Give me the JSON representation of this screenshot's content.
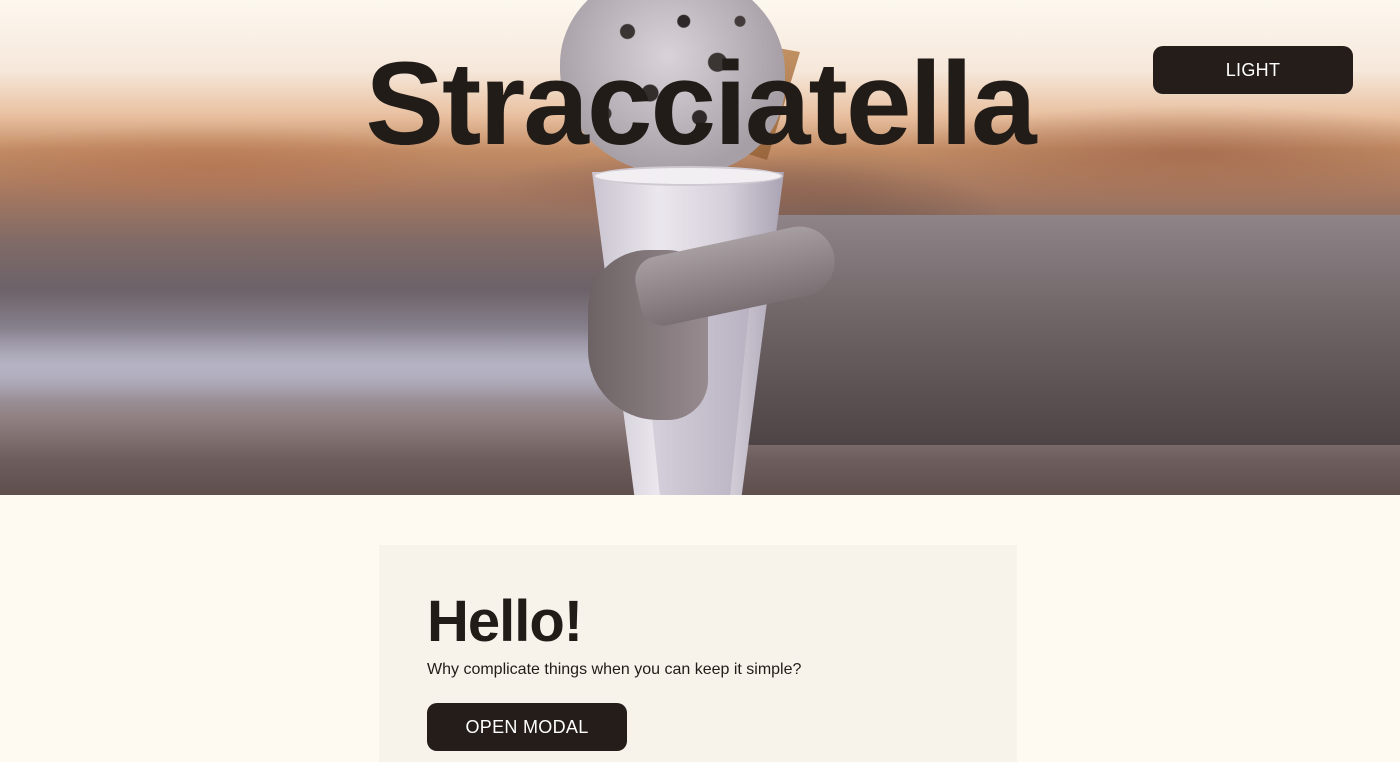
{
  "hero": {
    "title": "Stracciatella",
    "image_alt": "hand holding an ice cream cone",
    "theme_toggle_label": "LIGHT"
  },
  "card": {
    "title": "Hello!",
    "text": "Why complicate things when you can keep it simple?",
    "button_label": "OPEN MODAL"
  },
  "colors": {
    "background": "#fefaf2",
    "card_background": "#f8f3ea",
    "button_background": "#241d1a",
    "text": "#221c19"
  }
}
